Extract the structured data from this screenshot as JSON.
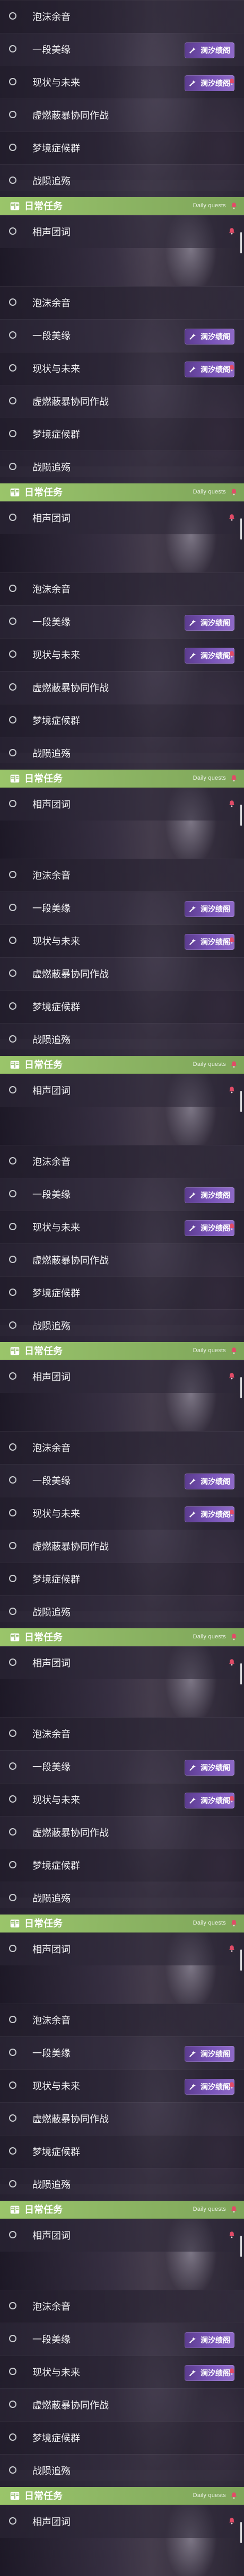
{
  "colors": {
    "section_bar": "#8fb865",
    "badge_primary": "#7a55b9",
    "badge_icon_fill": "#ffffff",
    "alert_red": "#e24b67",
    "text_primary": "#f0f0f2"
  },
  "list": {
    "panel_count": 9,
    "items": [
      {
        "label": "泡沫余音"
      },
      {
        "label": "一段美缘",
        "badge": {
          "text": "澜汐绩阁",
          "icon": "wand-icon"
        }
      },
      {
        "label": "现状与未来",
        "badge": {
          "text": "澜汐绩阁",
          "icon": "wand-icon"
        },
        "alert_icon": "bell-icon"
      },
      {
        "label": "虚燃蔽暴协同作战"
      },
      {
        "label": "梦境症候群"
      },
      {
        "label": "战陨追殇"
      },
      {
        "section": {
          "label": "日常任务",
          "subtitle": "Daily quests",
          "icon": "book-icon",
          "alert_icon": "bell-icon"
        }
      },
      {
        "label": "相声团词",
        "alert_icon": "bell-icon"
      }
    ]
  }
}
